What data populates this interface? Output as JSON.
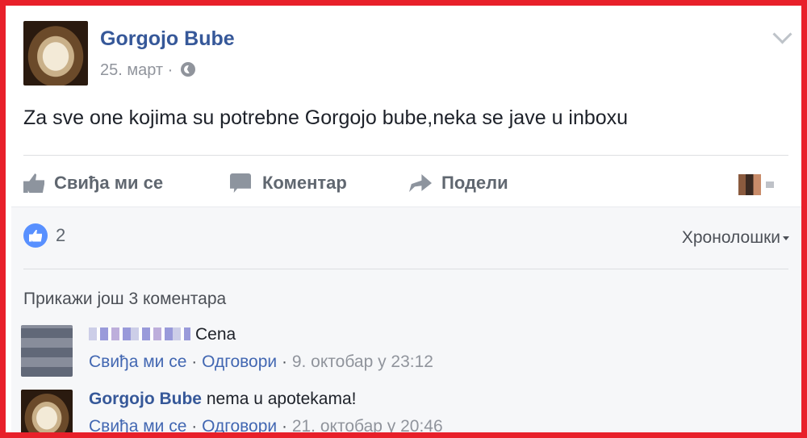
{
  "post": {
    "author": "Gorgojo Bube",
    "date": "25. март",
    "meta_sep": "·",
    "message": "Za sve one kojima su potrebne Gorgojo bube,neka se jave u inboxu"
  },
  "actions": {
    "like": "Свиђа ми се",
    "comment": "Коментар",
    "share": "Подели"
  },
  "reactions": {
    "count": "2",
    "sort": "Хронолошки"
  },
  "comments": {
    "more": "Прикажи још 3 коментара",
    "items": [
      {
        "name": "",
        "text": "Cena",
        "like": "Свиђа ми се",
        "sep": "·",
        "reply": "Одговори",
        "time": "9. октобар у 23:12"
      },
      {
        "name": "Gorgojo Bube",
        "text": "nema u apotekama!",
        "like": "Свиђа ми се",
        "sep": "·",
        "reply": "Одговори",
        "time": "21. октобар у 20:46"
      }
    ]
  },
  "colors": {
    "frame": "#e8202a",
    "link": "#365899",
    "like_bubble": "#5890ff"
  }
}
